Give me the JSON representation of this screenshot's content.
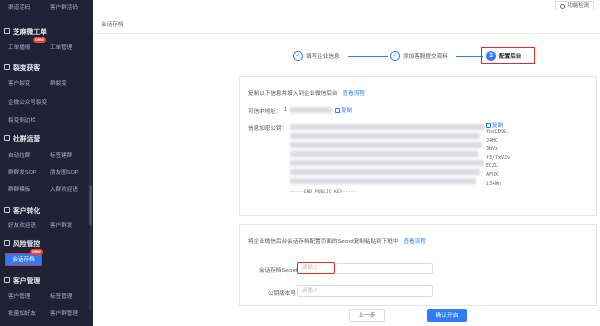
{
  "sidebar": {
    "top_items": [
      "渠道活码",
      "客户群活码"
    ],
    "sections": [
      {
        "key": "zhihe",
        "title": "芝麻微工单",
        "items": [
          "工单播报",
          "工单管理"
        ]
      },
      {
        "key": "fission",
        "title": "裂变获客",
        "items": [
          "客户裂变",
          "群裂变",
          "企微公众号裂变",
          "裂变侧边栏"
        ]
      },
      {
        "key": "community",
        "title": "社群运营",
        "items": [
          "自动拉群",
          "标签建群",
          "群群发SOP",
          "朋友圈SOP",
          "群群模板",
          "入群欢迎语"
        ]
      },
      {
        "key": "convert",
        "title": "客户转化",
        "items": [
          "好友欢迎语",
          "客户群发"
        ]
      },
      {
        "key": "risk",
        "title": "风险管控",
        "items": [
          "会话存档"
        ]
      },
      {
        "key": "customer",
        "title": "客户管理",
        "items": [
          "客户管理",
          "标签管理",
          "批量加好友",
          "客户群管理"
        ]
      }
    ],
    "new_badge": "new"
  },
  "topbar": {
    "function_button": "功能检测"
  },
  "breadcrumb": "会话存档",
  "steps": [
    {
      "num": "✓",
      "label": "填写企业信息"
    },
    {
      "num": "✓",
      "label": "添加客服提交资料"
    },
    {
      "num": "3",
      "label": "配置后台"
    }
  ],
  "panel1": {
    "instruction": "复制以下信息并填入到企业微信后台",
    "view_flow": "查看流程",
    "callback_label": "可信IP地址：",
    "callback_prefix": "1",
    "copy": "复制",
    "key_label": "信息加密公钥：",
    "key_tail": [
      "YosLD9L",
      "J4HC",
      "3hVx",
      "f3/7xV2v",
      "ECZL",
      "AFUX",
      "i3+Wn"
    ],
    "key_end": "-----END PUBLIC KEY-----"
  },
  "panel2": {
    "instruction": "将企业微信后台会话存档配置页面的Secret复制粘贴到下框中",
    "view_flow": "查看流程",
    "secret_label": "会话存档Secret：",
    "secret_placeholder": "请输入",
    "pubkey_label": "公钥版本号：",
    "pubkey_placeholder": "请输入"
  },
  "buttons": {
    "prev": "上一步",
    "confirm": "确认开启"
  },
  "colors": {
    "primary": "#2f7cf6",
    "highlight": "#e22c2c",
    "sidebar": "#1f2235"
  }
}
